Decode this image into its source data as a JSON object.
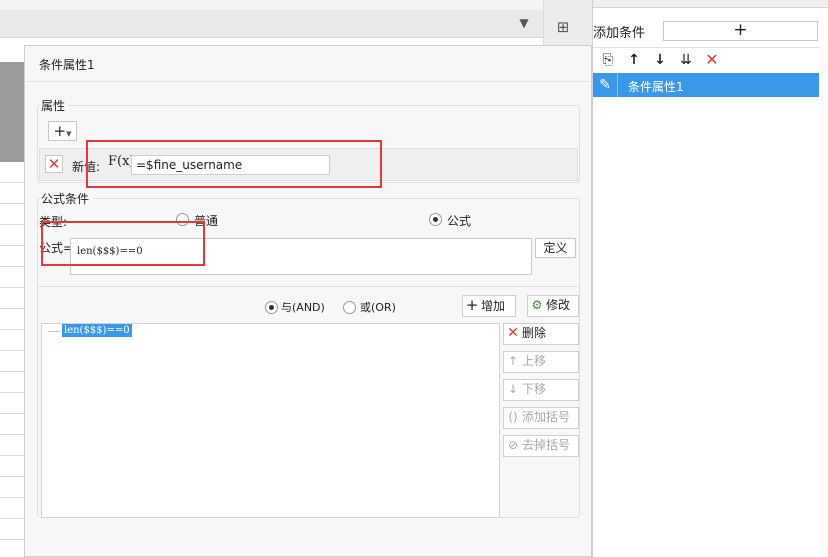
{
  "bg": {
    "toolbar_icon": "format-painter-icon",
    "strip_icon": "panel-layout-icon"
  },
  "right_panel": {
    "title": "条件属性",
    "add_condition_label": "添加条件",
    "add_button_symbol": "+",
    "tools": [
      {
        "name": "copy-icon",
        "glyph": "⎘"
      },
      {
        "name": "arrow-up-icon",
        "glyph": "↑"
      },
      {
        "name": "arrow-down-icon",
        "glyph": "↓"
      },
      {
        "name": "move-bottom-icon",
        "glyph": "⇊"
      },
      {
        "name": "delete-icon",
        "glyph": "✕"
      }
    ],
    "selected_item": "条件属性1"
  },
  "dialog": {
    "title": "条件属性1",
    "attr_group_label": "属性",
    "add_attr_symbol": "+",
    "new_value_label": "新值:",
    "fx_label": "F(x)",
    "new_value": "=$fine_username",
    "formula_group_label": "公式条件",
    "type_label": "类型:",
    "type_normal": "普通",
    "type_formula": "公式",
    "type_selected": "公式",
    "formula_label": "公式=",
    "formula_value": "len($$$)==0",
    "define_button": "定义",
    "logic_and": "与(AND)",
    "logic_or": "或(OR)",
    "logic_selected": "与(AND)",
    "add_button": "增加",
    "modify_button": "修改",
    "delete_button": "删除",
    "move_up_button": "上移",
    "move_down_button": "下移",
    "add_bracket_button": "添加括号",
    "remove_bracket_button": "去掉括号",
    "conditions": [
      "len($$$)==0"
    ]
  },
  "colors": {
    "accent": "#3a98ea",
    "highlight_box": "#e53935"
  }
}
